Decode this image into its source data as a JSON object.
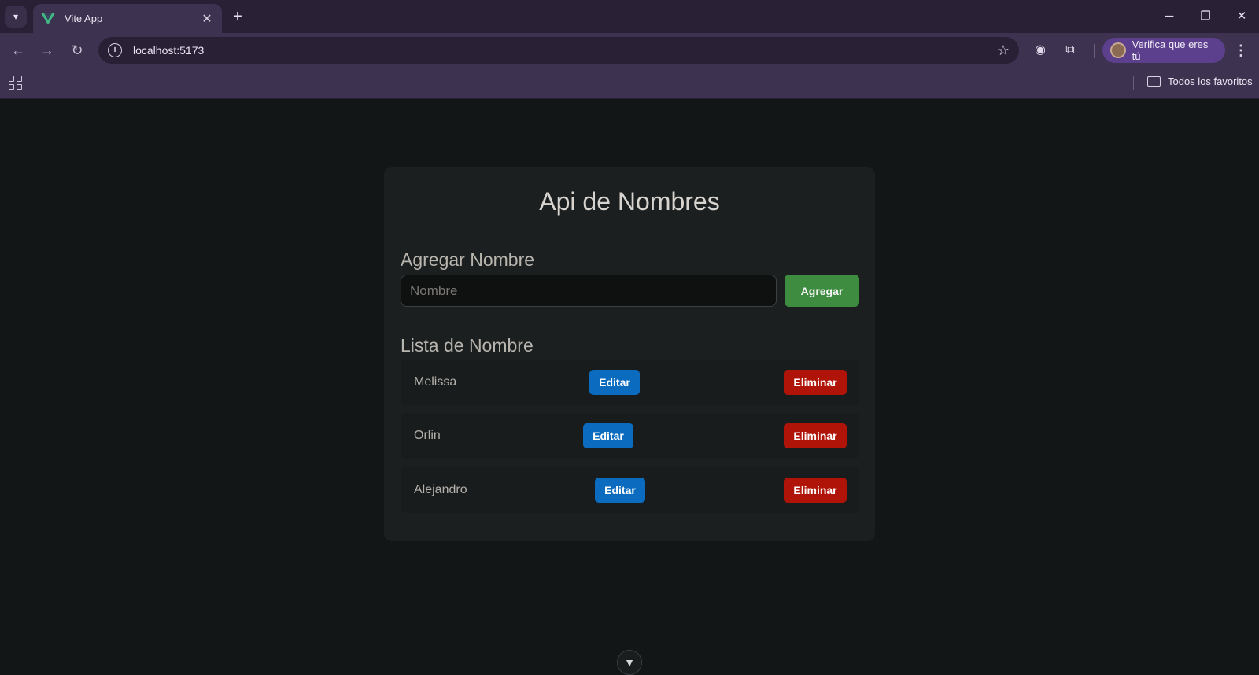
{
  "browser": {
    "tab_title": "Vite App",
    "url": "localhost:5173",
    "profile_label": "Verifica que eres tú",
    "bookmark_folder": "Todos los favoritos"
  },
  "app": {
    "title": "Api de Nombres",
    "add_section_title": "Agregar Nombre",
    "input_placeholder": "Nombre",
    "add_button": "Agregar",
    "list_section_title": "Lista de Nombre",
    "items": [
      {
        "name": "Melissa",
        "edit": "Editar",
        "delete": "Eliminar"
      },
      {
        "name": "Orlin",
        "edit": "Editar",
        "delete": "Eliminar"
      },
      {
        "name": "Alejandro",
        "edit": "Editar",
        "delete": "Eliminar"
      }
    ]
  },
  "colors": {
    "add_button": "#3d8c40",
    "edit_button": "#0b6cbf",
    "delete_button": "#b01408",
    "vue_logo": "#41b883"
  }
}
